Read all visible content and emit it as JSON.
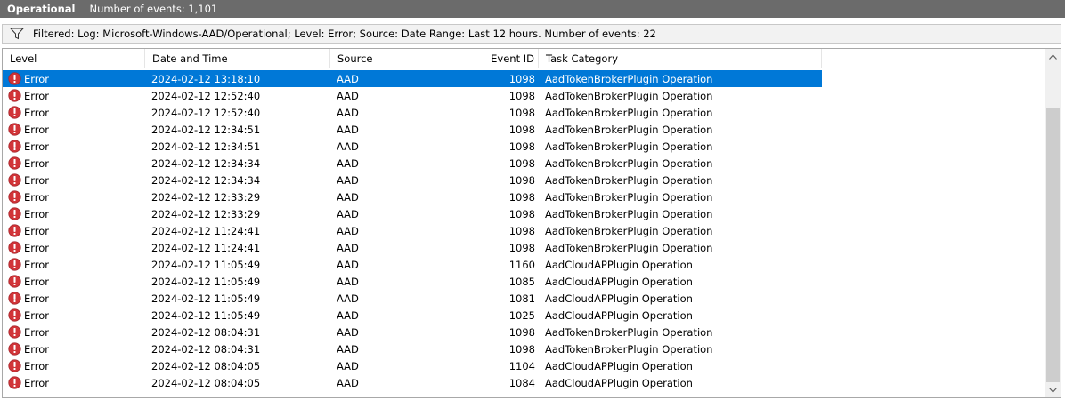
{
  "titlebar": {
    "title": "Operational",
    "event_count": "Number of events: 1,101"
  },
  "filter": {
    "text": "Filtered: Log: Microsoft-Windows-AAD/Operational; Level: Error; Source: Date Range: Last 12 hours. Number of events: 22"
  },
  "columns": {
    "level": "Level",
    "date": "Date and Time",
    "source": "Source",
    "event_id": "Event ID",
    "task": "Task Category"
  },
  "colors": {
    "selection": "#0078d7",
    "error_icon": "#d13438"
  },
  "selected_row": 0,
  "rows": [
    {
      "level": "Error",
      "date": "2024-02-12 13:18:10",
      "source": "AAD",
      "event_id": "1098",
      "task": "AadTokenBrokerPlugin Operation"
    },
    {
      "level": "Error",
      "date": "2024-02-12 12:52:40",
      "source": "AAD",
      "event_id": "1098",
      "task": "AadTokenBrokerPlugin Operation"
    },
    {
      "level": "Error",
      "date": "2024-02-12 12:52:40",
      "source": "AAD",
      "event_id": "1098",
      "task": "AadTokenBrokerPlugin Operation"
    },
    {
      "level": "Error",
      "date": "2024-02-12 12:34:51",
      "source": "AAD",
      "event_id": "1098",
      "task": "AadTokenBrokerPlugin Operation"
    },
    {
      "level": "Error",
      "date": "2024-02-12 12:34:51",
      "source": "AAD",
      "event_id": "1098",
      "task": "AadTokenBrokerPlugin Operation"
    },
    {
      "level": "Error",
      "date": "2024-02-12 12:34:34",
      "source": "AAD",
      "event_id": "1098",
      "task": "AadTokenBrokerPlugin Operation"
    },
    {
      "level": "Error",
      "date": "2024-02-12 12:34:34",
      "source": "AAD",
      "event_id": "1098",
      "task": "AadTokenBrokerPlugin Operation"
    },
    {
      "level": "Error",
      "date": "2024-02-12 12:33:29",
      "source": "AAD",
      "event_id": "1098",
      "task": "AadTokenBrokerPlugin Operation"
    },
    {
      "level": "Error",
      "date": "2024-02-12 12:33:29",
      "source": "AAD",
      "event_id": "1098",
      "task": "AadTokenBrokerPlugin Operation"
    },
    {
      "level": "Error",
      "date": "2024-02-12 11:24:41",
      "source": "AAD",
      "event_id": "1098",
      "task": "AadTokenBrokerPlugin Operation"
    },
    {
      "level": "Error",
      "date": "2024-02-12 11:24:41",
      "source": "AAD",
      "event_id": "1098",
      "task": "AadTokenBrokerPlugin Operation"
    },
    {
      "level": "Error",
      "date": "2024-02-12 11:05:49",
      "source": "AAD",
      "event_id": "1160",
      "task": "AadCloudAPPlugin Operation"
    },
    {
      "level": "Error",
      "date": "2024-02-12 11:05:49",
      "source": "AAD",
      "event_id": "1085",
      "task": "AadCloudAPPlugin Operation"
    },
    {
      "level": "Error",
      "date": "2024-02-12 11:05:49",
      "source": "AAD",
      "event_id": "1081",
      "task": "AadCloudAPPlugin Operation"
    },
    {
      "level": "Error",
      "date": "2024-02-12 11:05:49",
      "source": "AAD",
      "event_id": "1025",
      "task": "AadCloudAPPlugin Operation"
    },
    {
      "level": "Error",
      "date": "2024-02-12 08:04:31",
      "source": "AAD",
      "event_id": "1098",
      "task": "AadTokenBrokerPlugin Operation"
    },
    {
      "level": "Error",
      "date": "2024-02-12 08:04:31",
      "source": "AAD",
      "event_id": "1098",
      "task": "AadTokenBrokerPlugin Operation"
    },
    {
      "level": "Error",
      "date": "2024-02-12 08:04:05",
      "source": "AAD",
      "event_id": "1104",
      "task": "AadCloudAPPlugin Operation"
    },
    {
      "level": "Error",
      "date": "2024-02-12 08:04:05",
      "source": "AAD",
      "event_id": "1084",
      "task": "AadCloudAPPlugin Operation"
    }
  ]
}
